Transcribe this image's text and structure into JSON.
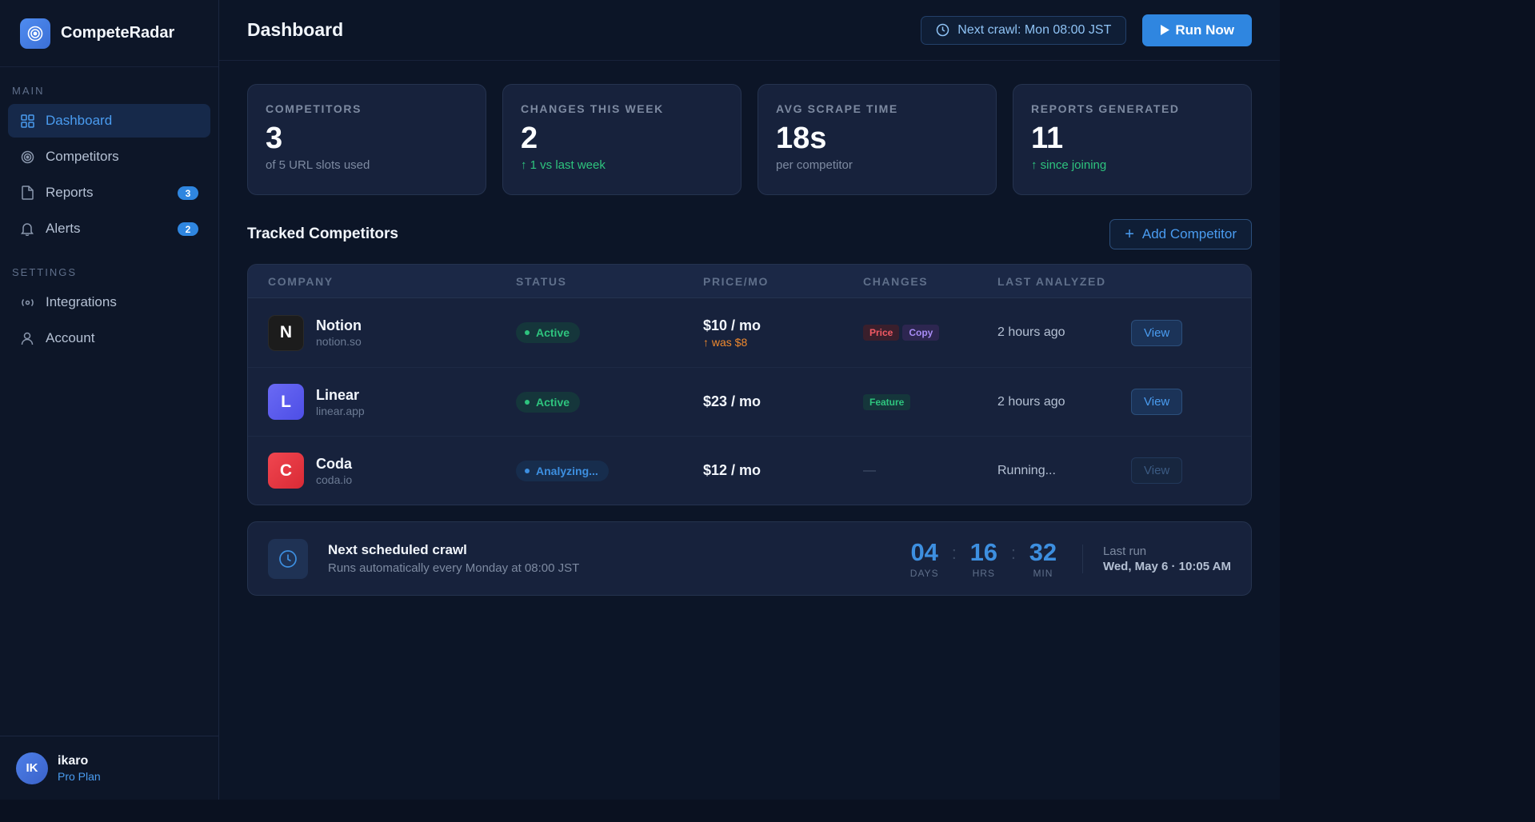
{
  "brand": {
    "name": "CompeteRadar",
    "icon": "radar-icon"
  },
  "sidebar": {
    "sections": [
      {
        "label": "MAIN"
      },
      {
        "label": "SETTINGS"
      }
    ],
    "items": [
      {
        "label": "Dashboard",
        "icon": "grid-icon",
        "active": true
      },
      {
        "label": "Competitors",
        "icon": "target-icon"
      },
      {
        "label": "Reports",
        "icon": "document-icon",
        "badge": "3"
      },
      {
        "label": "Alerts",
        "icon": "bell-icon",
        "badge": "2"
      },
      {
        "label": "Integrations",
        "icon": "integrations-icon"
      },
      {
        "label": "Account",
        "icon": "user-icon"
      }
    ]
  },
  "user": {
    "initials": "IK",
    "name": "ikaro",
    "plan": "Pro Plan"
  },
  "header": {
    "title": "Dashboard",
    "next_crawl": "Next crawl: Mon 08:00 JST",
    "run_now": "Run Now"
  },
  "stats": [
    {
      "label": "COMPETITORS",
      "value": "3",
      "sub": "of 5 URL slots used"
    },
    {
      "label": "CHANGES THIS WEEK",
      "value": "2",
      "sub": "↑ 1 vs last week"
    },
    {
      "label": "AVG SCRAPE TIME",
      "value": "18s",
      "sub": "per competitor"
    },
    {
      "label": "REPORTS GENERATED",
      "value": "11",
      "sub": "↑ since joining"
    }
  ],
  "competitors": {
    "title": "Tracked Competitors",
    "add_label": "Add Competitor",
    "columns": [
      "COMPANY",
      "STATUS",
      "PRICE/MO",
      "CHANGES",
      "LAST ANALYZED"
    ],
    "rows": [
      {
        "letter": "N",
        "name": "Notion",
        "url": "notion.so",
        "status": "Active",
        "price": "$10 / mo",
        "price_delta": "↑ was $8",
        "tags": [
          "Price",
          "Copy"
        ],
        "last": "2 hours ago",
        "action": "View"
      },
      {
        "letter": "L",
        "name": "Linear",
        "url": "linear.app",
        "status": "Active",
        "price": "$23 / mo",
        "price_delta": "",
        "tags": [
          "Feature"
        ],
        "last": "2 hours ago",
        "action": "View"
      },
      {
        "letter": "C",
        "name": "Coda",
        "url": "coda.io",
        "status": "Analyzing...",
        "price": "$12 / mo",
        "price_delta": "",
        "tags": [],
        "changes_empty": "—",
        "last": "Running...",
        "action": "View"
      }
    ]
  },
  "schedule": {
    "title": "Next scheduled crawl",
    "subtitle": "Runs automatically every Monday at 08:00 JST",
    "days": "04",
    "days_label": "DAYS",
    "hours": "16",
    "hours_label": "HRS",
    "minutes": "32",
    "minutes_label": "MIN",
    "separator": ":",
    "last_run_label": "Last run",
    "last_run_value": "Wed, May 6 · 10:05 AM"
  },
  "colors": {
    "accent": "#2f86e0",
    "success": "#2ec47e",
    "warning": "#f08a2e",
    "danger": "#f25a64",
    "notion_logo": "#1c1c1c",
    "linear_logo": "#5b5bef",
    "coda_logo": "#e8353f"
  }
}
